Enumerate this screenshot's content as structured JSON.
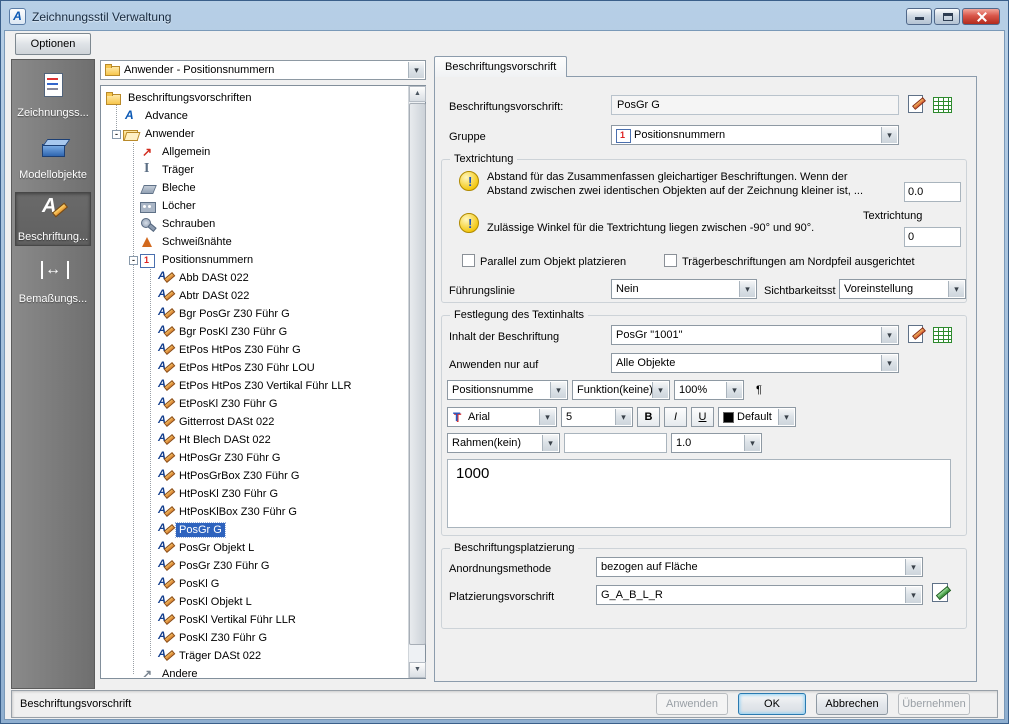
{
  "window": {
    "title": "Zeichnungsstil Verwaltung",
    "app_icon": "A"
  },
  "toolbar": {
    "options_label": "Optionen",
    "icons": [
      {
        "name": "check-document-icon"
      },
      {
        "name": "edit-document-icon"
      },
      {
        "name": "new-document-icon"
      },
      {
        "name": "copy-icon"
      },
      {
        "name": "paste-icon"
      },
      {
        "name": "delete-icon"
      },
      {
        "name": "import-style-icon"
      },
      {
        "name": "export-style-icon"
      },
      {
        "name": "preview-icon"
      },
      {
        "name": "help-icon"
      }
    ],
    "nav": [
      {
        "name": "back-icon"
      },
      {
        "name": "forward-icon"
      },
      {
        "name": "up-icon"
      }
    ]
  },
  "sidebar": {
    "items": [
      {
        "name": "sidebar-item-zeichnungsstile",
        "icon": "drawing-style",
        "label": "Zeichnungss..."
      },
      {
        "name": "sidebar-item-modellobjekte",
        "icon": "model-objects",
        "label": "Modellobjekte"
      },
      {
        "name": "sidebar-item-beschriftung",
        "icon": "annotation",
        "label": "Beschriftung...",
        "selected": true
      },
      {
        "name": "sidebar-item-bemassung",
        "icon": "dimension",
        "label": "Bemaßungs..."
      }
    ]
  },
  "tree": {
    "filter_value": "Anwender - Positionsnummern",
    "items": [
      {
        "depth": 0,
        "icon": "folder-closed",
        "label": "Beschriftungsvorschriften"
      },
      {
        "depth": 1,
        "icon": "advance-logo",
        "label": "Advance"
      },
      {
        "depth": 1,
        "icon": "folder-open",
        "label": "Anwender",
        "expander": "minus"
      },
      {
        "depth": 2,
        "icon": "general",
        "label": "Allgemein"
      },
      {
        "depth": 2,
        "icon": "beam",
        "label": "Träger"
      },
      {
        "depth": 2,
        "icon": "plate",
        "label": "Bleche"
      },
      {
        "depth": 2,
        "icon": "holes",
        "label": "Löcher"
      },
      {
        "depth": 2,
        "icon": "bolt",
        "label": "Schrauben"
      },
      {
        "depth": 2,
        "icon": "weld",
        "label": "Schweißnähte"
      },
      {
        "depth": 2,
        "icon": "posnum",
        "label": "Positionsnummern",
        "expander": "minus"
      },
      {
        "depth": 3,
        "icon": "note",
        "label": "Abb DASt 022"
      },
      {
        "depth": 3,
        "icon": "note",
        "label": "Abtr DASt 022"
      },
      {
        "depth": 3,
        "icon": "note",
        "label": "Bgr PosGr Z30 Führ G"
      },
      {
        "depth": 3,
        "icon": "note",
        "label": "Bgr PosKl Z30 Führ G"
      },
      {
        "depth": 3,
        "icon": "note",
        "label": "EtPos HtPos Z30 Führ G"
      },
      {
        "depth": 3,
        "icon": "note",
        "label": "EtPos HtPos Z30 Führ LOU"
      },
      {
        "depth": 3,
        "icon": "note",
        "label": "EtPos HtPos Z30 Vertikal Führ LLR"
      },
      {
        "depth": 3,
        "icon": "note",
        "label": "EtPosKl Z30 Führ G"
      },
      {
        "depth": 3,
        "icon": "note",
        "label": "Gitterrost DASt 022"
      },
      {
        "depth": 3,
        "icon": "note",
        "label": "Ht Blech DASt 022"
      },
      {
        "depth": 3,
        "icon": "note",
        "label": "HtPosGr Z30 Führ G"
      },
      {
        "depth": 3,
        "icon": "note",
        "label": "HtPosGrBox Z30 Führ G"
      },
      {
        "depth": 3,
        "icon": "note",
        "label": "HtPosKl Z30 Führ G"
      },
      {
        "depth": 3,
        "icon": "note",
        "label": "HtPosKlBox Z30 Führ G"
      },
      {
        "depth": 3,
        "icon": "note",
        "label": "PosGr G",
        "selected": true
      },
      {
        "depth": 3,
        "icon": "note",
        "label": "PosGr Objekt L"
      },
      {
        "depth": 3,
        "icon": "note",
        "label": "PosGr Z30 Führ G"
      },
      {
        "depth": 3,
        "icon": "note",
        "label": "PosKl G"
      },
      {
        "depth": 3,
        "icon": "note",
        "label": "PosKl Objekt L"
      },
      {
        "depth": 3,
        "icon": "note",
        "label": "PosKl Vertikal Führ LLR"
      },
      {
        "depth": 3,
        "icon": "note",
        "label": "PosKl Z30 Führ G"
      },
      {
        "depth": 3,
        "icon": "note",
        "label": "Träger DASt 022"
      },
      {
        "depth": 2,
        "icon": "other",
        "label": "Andere"
      }
    ]
  },
  "panel": {
    "tab_label": "Beschriftungsvorschrift",
    "name_label": "Beschriftungsvorschrift:",
    "name_value": "PosGr G",
    "gruppe_label": "Gruppe",
    "gruppe_value": "Positionsnummern",
    "textrichtung": {
      "group_label": "Textrichtung",
      "hint1_line1": "Abstand für das Zusammenfassen gleichartiger Beschriftungen. Wenn der",
      "hint1_line2": "Abstand  zwischen zwei identischen Objekten auf der Zeichnung kleiner ist, ...",
      "distance_value": "0.0",
      "hint2": "Zulässige Winkel für die Textrichtung liegen zwischen -90° und 90°.",
      "direction_label": "Textrichtung",
      "direction_value": "0",
      "checkbox1": "Parallel zum Objekt platzieren",
      "checkbox2": "Trägerbeschriftungen am Nordpfeil ausgerichtet",
      "fuehrungslinie_label": "Führungslinie",
      "fuehrungslinie_value": "Nein",
      "sichtbarkeit_label": "Sichtbarkeitsst",
      "sichtbarkeit_value": "Voreinstellung"
    },
    "textinhalt": {
      "group_label": "Festlegung des Textinhalts",
      "inhalt_label": "Inhalt der Beschriftung",
      "inhalt_value": "PosGr \"1001\"",
      "anwenden_label": "Anwenden nur auf",
      "anwenden_value": "Alle Objekte",
      "token_combo": "Positionsnumme",
      "funktion_combo": "Funktion(keine)",
      "zoom_combo": "100%",
      "pilcrow": "¶",
      "font_name": "Arial",
      "font_size": "5",
      "bold": "B",
      "italic": "I",
      "underline": "U",
      "color_value": "Default",
      "rahmen_combo": "Rahmen(kein)",
      "rahmen_field": "",
      "line_weight": "1.0",
      "preview_text": "1000"
    },
    "platzierung": {
      "group_label": "Beschriftungsplatzierung",
      "anordnung_label": "Anordnungsmethode",
      "anordnung_value": "bezogen auf Fläche",
      "vorschrift_label": "Platzierungsvorschrift",
      "vorschrift_value": "G_A_B_L_R"
    }
  },
  "footer": {
    "status": "Beschriftungsvorschrift",
    "buttons": [
      {
        "name": "anwenden-button",
        "label": "Anwenden",
        "state": "disabled"
      },
      {
        "name": "ok-button",
        "label": "OK",
        "state": "default"
      },
      {
        "name": "abbrechen-button",
        "label": "Abbrechen",
        "state": "normal"
      },
      {
        "name": "uebernehmen-button",
        "label": "Übernehmen",
        "state": "disabled"
      }
    ]
  },
  "icons_catalog": [
    "advance-app-icon",
    "minimize-icon",
    "maximize-icon",
    "close-icon",
    "check-document-icon",
    "edit-document-icon",
    "new-document-icon",
    "copy-icon",
    "paste-icon",
    "delete-icon",
    "import-style-icon",
    "export-style-icon",
    "preview-icon",
    "help-icon",
    "back-icon",
    "forward-icon",
    "up-icon",
    "folder-icon",
    "folder-open-icon",
    "advance-logo-icon",
    "positionsnummern-icon",
    "annotation-note-icon",
    "hint-lightbulb-icon",
    "font-tt-icon",
    "color-swatch-icon",
    "sheet-pencil-icon",
    "table-green-icon",
    "sheet-green-pencil-icon",
    "chevron-down-icon",
    "scroll-up-icon",
    "scroll-down-icon",
    "expander-icon",
    "pilcrow-icon"
  ]
}
